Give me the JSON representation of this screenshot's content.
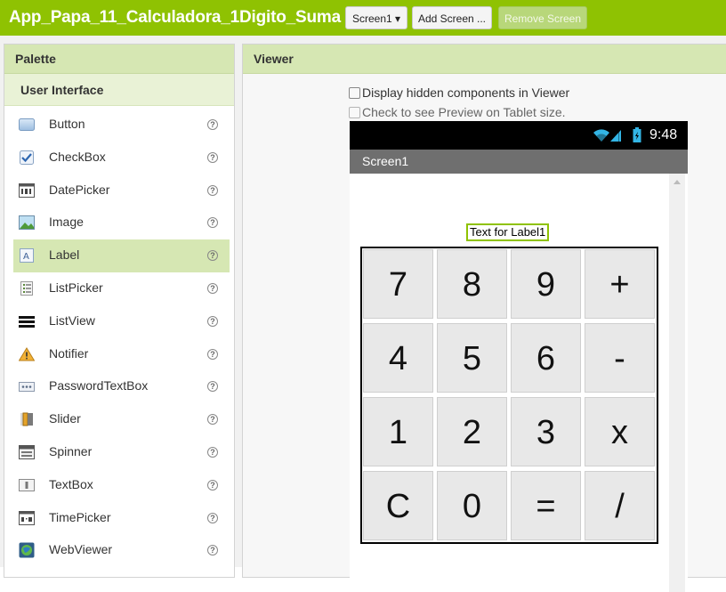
{
  "header": {
    "app_title": "App_Papa_11_Calculadora_1Digito_Suma",
    "screen_select_label": "Screen1 ▾",
    "add_screen_label": "Add Screen ...",
    "remove_screen_label": "Remove Screen"
  },
  "palette": {
    "title": "Palette",
    "category": "User Interface",
    "help_glyph": "?",
    "items": [
      {
        "label": "Button",
        "icon": "button-icon"
      },
      {
        "label": "CheckBox",
        "icon": "checkbox-icon"
      },
      {
        "label": "DatePicker",
        "icon": "datepicker-icon"
      },
      {
        "label": "Image",
        "icon": "image-icon"
      },
      {
        "label": "Label",
        "icon": "label-icon",
        "selected": true
      },
      {
        "label": "ListPicker",
        "icon": "listpicker-icon"
      },
      {
        "label": "ListView",
        "icon": "listview-icon"
      },
      {
        "label": "Notifier",
        "icon": "notifier-icon"
      },
      {
        "label": "PasswordTextBox",
        "icon": "passwordtextbox-icon"
      },
      {
        "label": "Slider",
        "icon": "slider-icon"
      },
      {
        "label": "Spinner",
        "icon": "spinner-icon"
      },
      {
        "label": "TextBox",
        "icon": "textbox-icon"
      },
      {
        "label": "TimePicker",
        "icon": "timepicker-icon"
      },
      {
        "label": "WebViewer",
        "icon": "webviewer-icon"
      }
    ]
  },
  "viewer": {
    "title": "Viewer",
    "hidden_components_label": "Display hidden components in Viewer",
    "tablet_preview_label": "Check to see Preview on Tablet size."
  },
  "phone": {
    "time": "9:48",
    "screen_title": "Screen1",
    "label1_text": "Text for Label1",
    "keys": [
      [
        "7",
        "8",
        "9",
        "+"
      ],
      [
        "4",
        "5",
        "6",
        "-"
      ],
      [
        "1",
        "2",
        "3",
        "x"
      ],
      [
        "C",
        "0",
        "=",
        "/"
      ]
    ]
  },
  "colors": {
    "accent": "#8fc202",
    "panel_header": "#d6e7b3",
    "selected_row": "#d6e7b3",
    "status_bar": "#000000",
    "title_bar": "#6f6f6f",
    "wifi": "#33b5e5"
  }
}
